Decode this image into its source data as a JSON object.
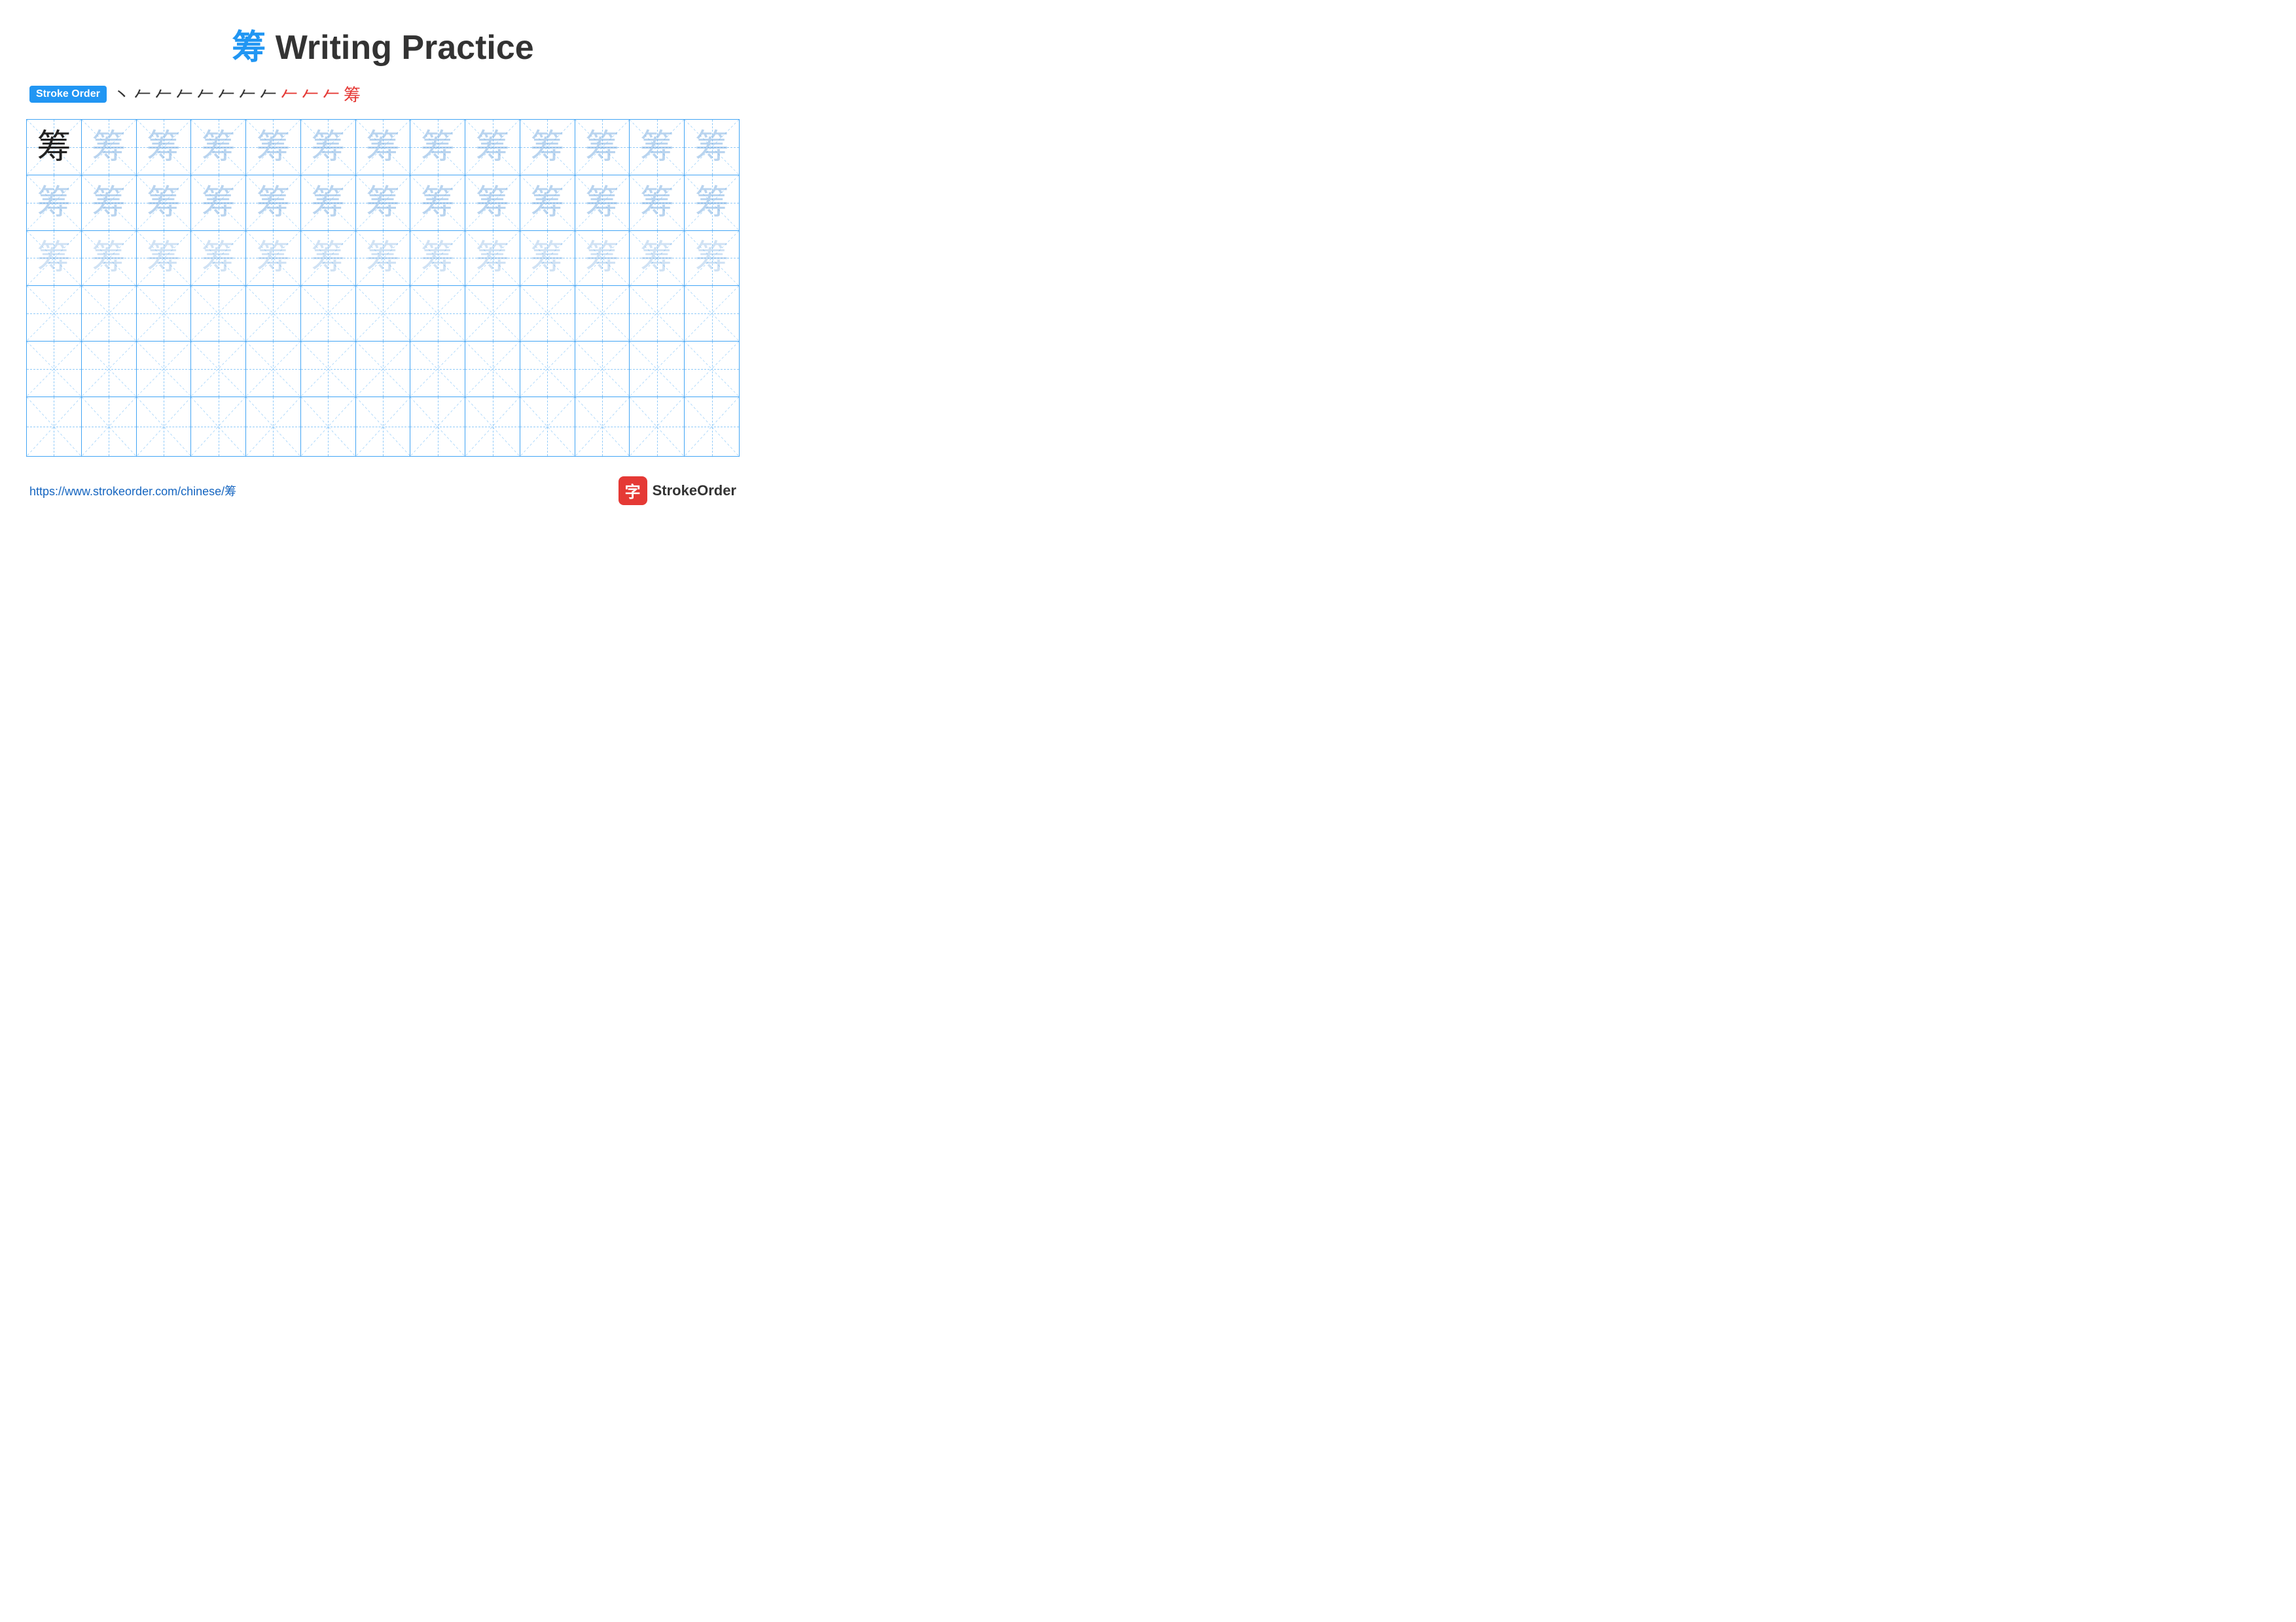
{
  "title": {
    "char": "筹",
    "text": " Writing Practice"
  },
  "stroke_order": {
    "badge_label": "Stroke Order",
    "steps": [
      "㇀",
      "㇀",
      "㇀",
      "㇀",
      "㇀",
      "㇀",
      "㇀",
      "㇀",
      "㇀",
      "㇀",
      "㇀",
      "㇀",
      "筹"
    ]
  },
  "practice_char": "筹",
  "rows": [
    {
      "type": "dark_then_light1",
      "count": 13
    },
    {
      "type": "light1",
      "count": 13
    },
    {
      "type": "light2",
      "count": 13
    },
    {
      "type": "empty",
      "count": 13
    },
    {
      "type": "empty",
      "count": 13
    },
    {
      "type": "empty",
      "count": 13
    }
  ],
  "footer": {
    "url": "https://www.strokeorder.com/chinese/筹",
    "brand": "StrokeOrder"
  }
}
